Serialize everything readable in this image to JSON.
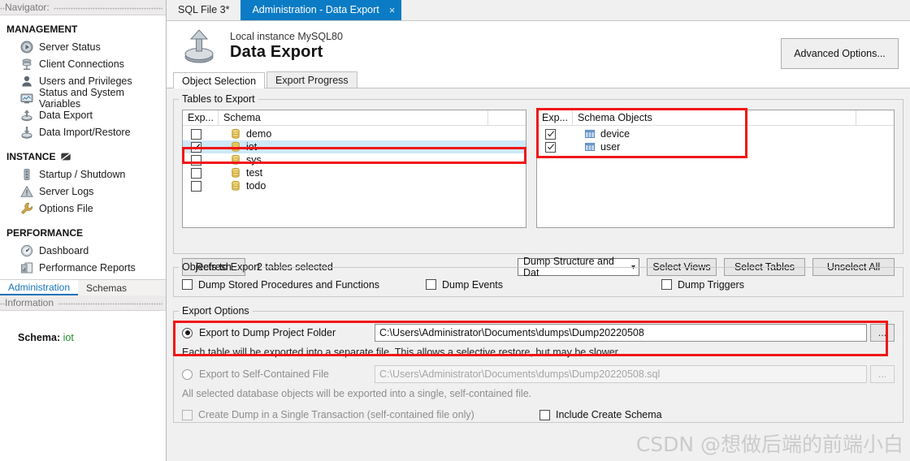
{
  "sidebar": {
    "caption": "Navigator:",
    "groups": [
      {
        "title": "MANAGEMENT",
        "icon": null,
        "items": [
          {
            "label": "Server Status",
            "icon": "server-status-icon"
          },
          {
            "label": "Client Connections",
            "icon": "client-connections-icon"
          },
          {
            "label": "Users and Privileges",
            "icon": "users-privileges-icon"
          },
          {
            "label": "Status and System Variables",
            "icon": "status-variables-icon"
          },
          {
            "label": "Data Export",
            "icon": "data-export-icon"
          },
          {
            "label": "Data Import/Restore",
            "icon": "data-import-icon"
          }
        ]
      },
      {
        "title": "INSTANCE",
        "icon": "instance-icon",
        "items": [
          {
            "label": "Startup / Shutdown",
            "icon": "startup-shutdown-icon"
          },
          {
            "label": "Server Logs",
            "icon": "server-logs-icon"
          },
          {
            "label": "Options File",
            "icon": "options-file-icon"
          }
        ]
      },
      {
        "title": "PERFORMANCE",
        "icon": null,
        "items": [
          {
            "label": "Dashboard",
            "icon": "dashboard-icon"
          },
          {
            "label": "Performance Reports",
            "icon": "performance-reports-icon"
          }
        ]
      }
    ],
    "bottom_tabs": [
      {
        "label": "Administration",
        "active": true
      },
      {
        "label": "Schemas",
        "active": false
      }
    ],
    "information_caption": "Information",
    "schema_label": "Schema:",
    "schema_value": "iot"
  },
  "tabs": [
    {
      "label": "SQL File 3*",
      "active": false,
      "closable": false
    },
    {
      "label": "Administration - Data Export",
      "active": true,
      "closable": true,
      "close_glyph": "×"
    }
  ],
  "header": {
    "subtitle": "Local instance MySQL80",
    "title": "Data Export",
    "icon": "data-export-icon",
    "advanced_button": "Advanced Options..."
  },
  "subtabs": [
    {
      "label": "Object Selection",
      "active": true
    },
    {
      "label": "Export Progress",
      "active": false
    }
  ],
  "tables_to_export": {
    "legend": "Tables to Export",
    "schema_columns": [
      "Exp...",
      "Schema",
      ""
    ],
    "schemas": [
      {
        "name": "demo",
        "checked": false,
        "selected": false
      },
      {
        "name": "iot",
        "checked": true,
        "selected": true
      },
      {
        "name": "sys",
        "checked": false,
        "selected": false
      },
      {
        "name": "test",
        "checked": false,
        "selected": false
      },
      {
        "name": "todo",
        "checked": false,
        "selected": false
      }
    ],
    "object_columns": [
      "Exp...",
      "Schema Objects",
      ""
    ],
    "objects": [
      {
        "name": "device",
        "checked": true
      },
      {
        "name": "user",
        "checked": true
      }
    ],
    "refresh_button": "Refresh",
    "selected_count": "2 tables selected",
    "dump_select_value": "Dump Structure and Dat",
    "select_views_button": "Select Views",
    "select_tables_button": "Select Tables",
    "unselect_all_button": "Unselect All"
  },
  "objects_to_export": {
    "legend": "Objects to Export",
    "checkboxes": [
      {
        "label": "Dump Stored Procedures and Functions",
        "checked": false
      },
      {
        "label": "Dump Events",
        "checked": false
      },
      {
        "label": "Dump Triggers",
        "checked": false
      }
    ]
  },
  "export_options": {
    "legend": "Export Options",
    "project_folder": {
      "label": "Export to Dump Project Folder",
      "selected": true,
      "path": "C:\\Users\\Administrator\\Documents\\dumps\\Dump20220508",
      "browse": "...",
      "hint": "Each table will be exported into a separate file. This allows a selective restore, but may be slower."
    },
    "self_contained": {
      "label": "Export to Self-Contained File",
      "selected": false,
      "path": "C:\\Users\\Administrator\\Documents\\dumps\\Dump20220508.sql",
      "browse": "...",
      "hint": "All selected database objects will be exported into a single, self-contained file."
    },
    "single_transaction": {
      "label": "Create Dump in a Single Transaction (self-contained file only)",
      "checked": false,
      "disabled": true
    },
    "include_create_schema": {
      "label": "Include Create Schema",
      "checked": false,
      "disabled": false
    }
  },
  "watermark": "CSDN @想做后端的前端小白",
  "colors": {
    "accent_blue": "#0a7bc4",
    "annotation_red": "#f01616",
    "schema_green": "#1f8a2f",
    "selection_blue": "#cfe8f7"
  }
}
